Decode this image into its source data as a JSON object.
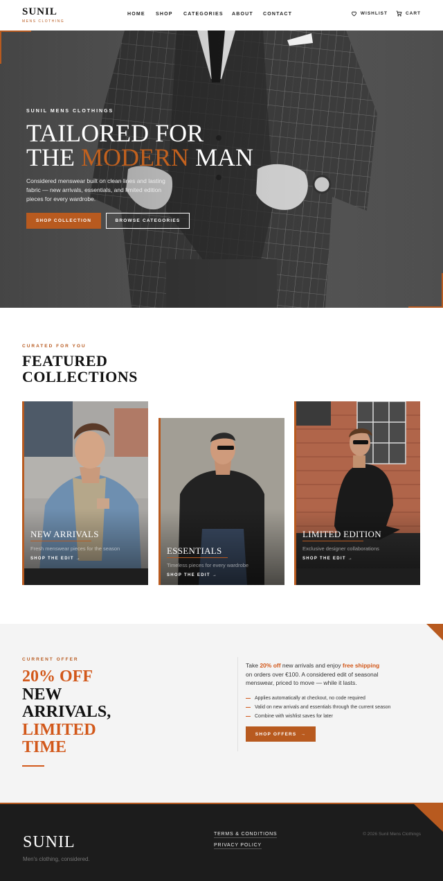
{
  "header": {
    "brand": "SUNIL",
    "brand_sub": "MENS CLOTHING",
    "nav": [
      "HOME",
      "SHOP",
      "CATEGORIES",
      "ABOUT",
      "CONTACT"
    ],
    "wishlist": "WISHLIST",
    "cart": "CART"
  },
  "hero": {
    "eyebrow": "SUNIL MENS CLOTHINGS",
    "title_line1": "TAILORED FOR",
    "title_line2_a": "THE ",
    "title_line2_accent": "MODERN",
    "title_line2_b": " MAN",
    "description": "Considered menswear built on clean lines and lasting fabric — new arrivals, essentials, and limited edition pieces for every wardrobe.",
    "primary_cta": "SHOP COLLECTION",
    "secondary_cta": "BROWSE CATEGORIES"
  },
  "featured": {
    "eyebrow": "CURATED FOR YOU",
    "title_line1": "FEATURED",
    "title_line2": "COLLECTIONS",
    "cards": [
      {
        "title": "NEW ARRIVALS",
        "subtitle": "Fresh menswear pieces for the season",
        "link": "SHOP THE EDIT →"
      },
      {
        "title": "ESSENTIALS",
        "subtitle": "Timeless pieces for every wardrobe",
        "link": "SHOP THE EDIT →"
      },
      {
        "title": "LIMITED EDITION",
        "subtitle": "Exclusive designer collaborations",
        "link": "SHOP THE EDIT →"
      }
    ]
  },
  "offer": {
    "eyebrow": "CURRENT OFFER",
    "title_pct": "20% OFF",
    "title_mid1": "NEW",
    "title_mid2": "ARRIVALS,",
    "title_end1": "LIMITED",
    "title_end2": "TIME",
    "text_a": "Take ",
    "text_pct": "20% off",
    "text_b": " new arrivals and enjoy ",
    "text_ship": "free shipping",
    "text_c": " on orders over €100. A considered edit of seasonal menswear, priced to move — while it lasts.",
    "bullets": [
      "Applies automatically at checkout, no code required",
      "Valid on new arrivals and essentials through the current season",
      "Combine with wishlist saves for later"
    ],
    "cta": "SHOP OFFERS  →"
  },
  "footer": {
    "brand": "SUNIL",
    "tagline": "Men's clothing, considered.",
    "links": [
      "TERMS & CONDITIONS",
      "PRIVACY POLICY"
    ],
    "copyright": "© 2026 Sunil Mens Clothings"
  },
  "colors": {
    "accent": "#b85a1f",
    "accent_bright": "#d2581a",
    "footer_bg": "#1c1c1c",
    "offer_bg": "#f4f4f4"
  }
}
